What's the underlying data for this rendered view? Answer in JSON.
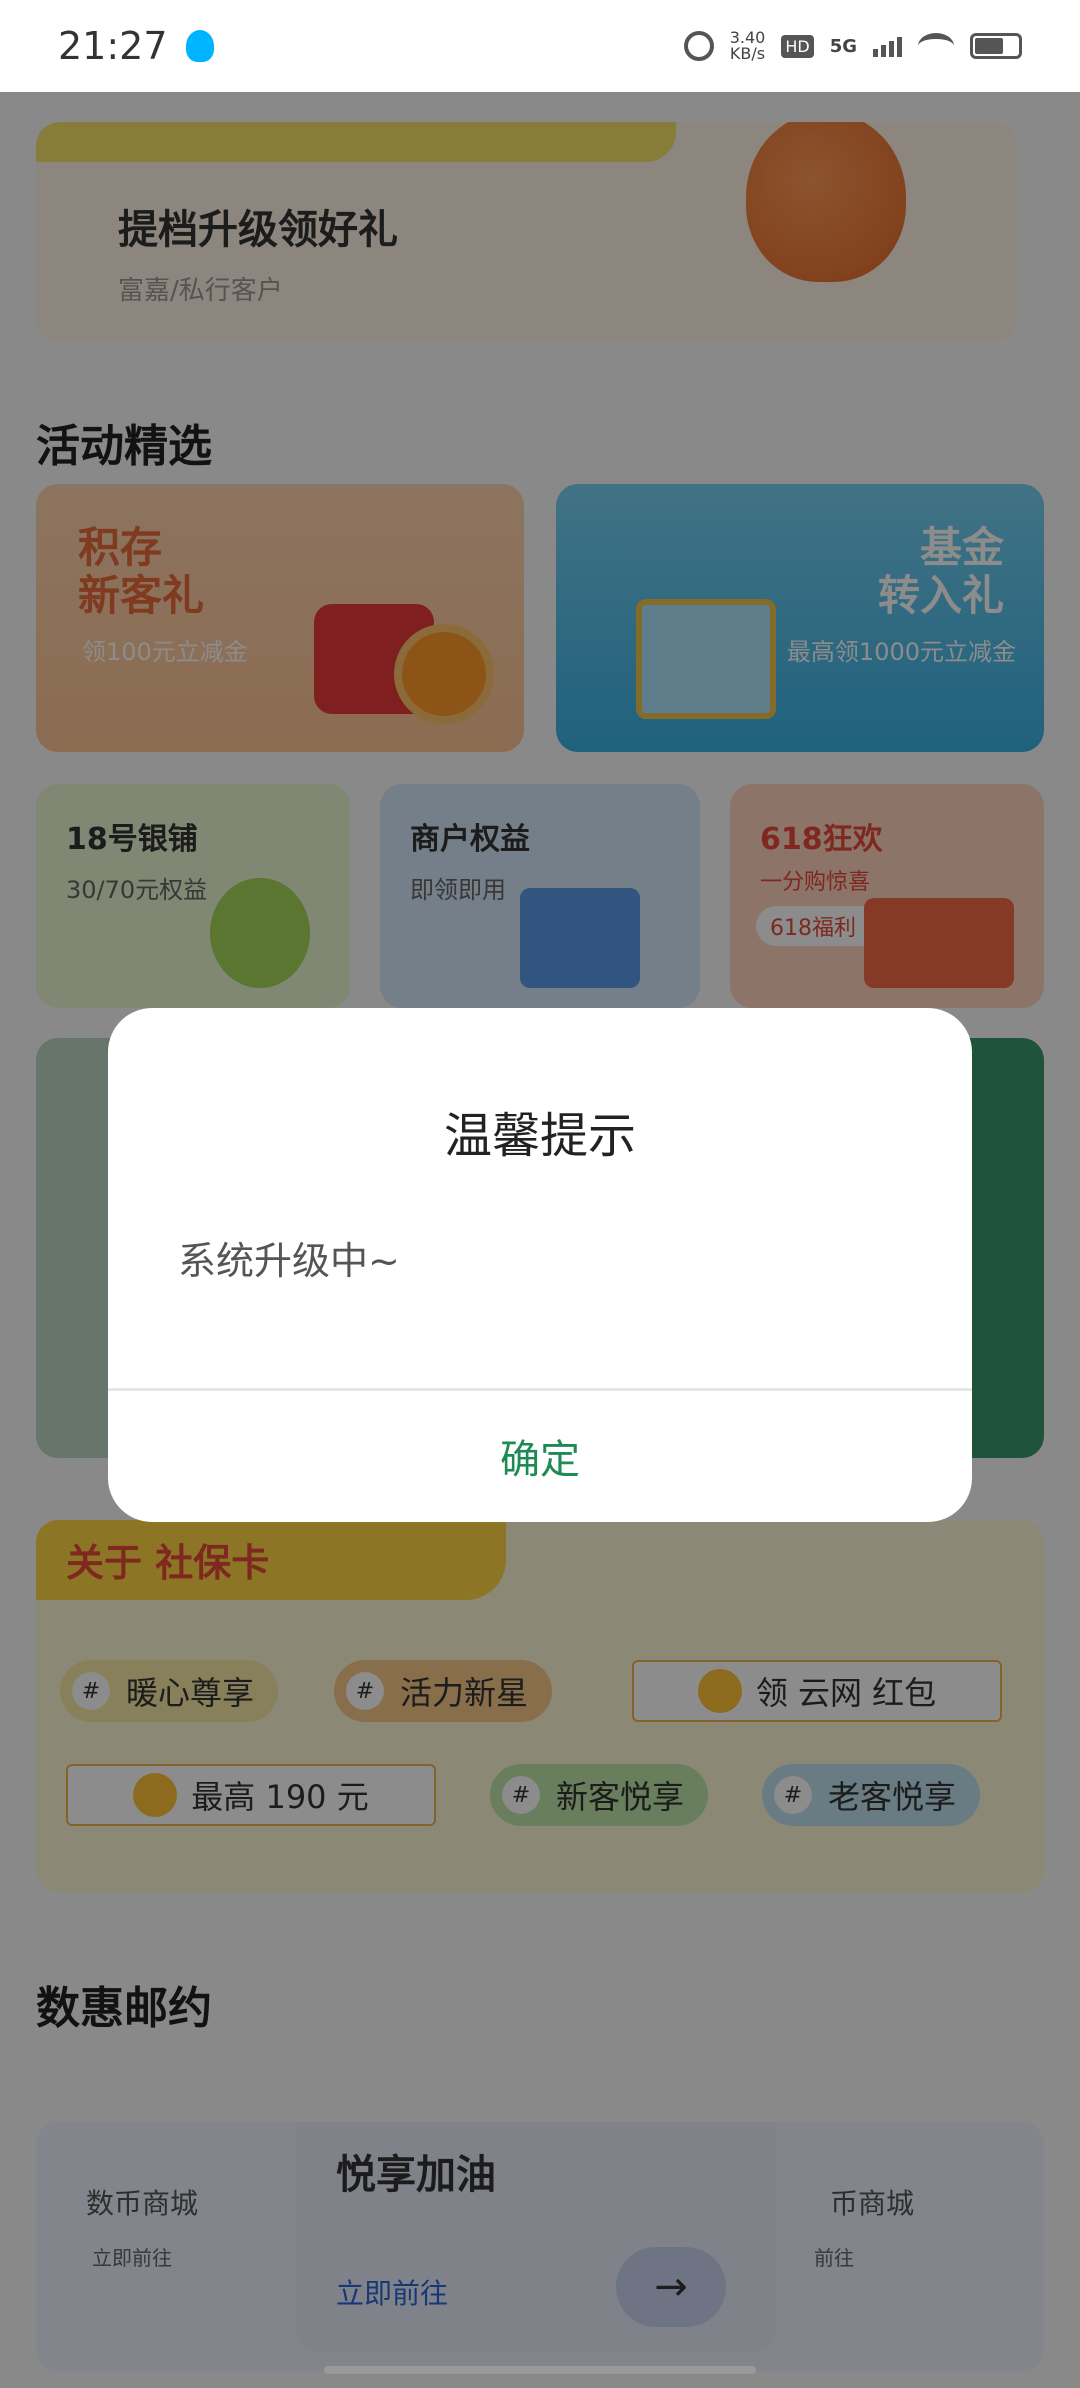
{
  "status_bar": {
    "time": "21:27",
    "speed": "3.40\nKB/s",
    "hd": "HD",
    "network": "5G",
    "colors": {
      "notify_icon": "#00b4ff"
    }
  },
  "hero": {
    "title": "提档升级领好礼",
    "subtitle": "富嘉/私行客户"
  },
  "activities": {
    "title": "活动精选",
    "card1": {
      "title": "积存\n新客礼",
      "sub": "领100元立减金"
    },
    "card2": {
      "title": "基金\n转入礼",
      "sub": "最高领1000元立减金"
    },
    "card3": {
      "title": "18号银铺",
      "sub": "30/70元权益"
    },
    "card4": {
      "title": "商户权益",
      "sub": "即领即用"
    },
    "card5": {
      "title": "618狂欢",
      "sub": "一分购惊喜",
      "pill": "618福利 ›"
    }
  },
  "social": {
    "tag": "关于 社保卡",
    "chips": [
      {
        "hash": "#",
        "label": "暖心尊享"
      },
      {
        "hash": "#",
        "label": "活力新星"
      },
      {
        "hash": "#",
        "label": "新客悦享"
      },
      {
        "hash": "#",
        "label": "老客悦享"
      }
    ],
    "redpacket": "领 云网 红包",
    "max": "最高 190 元"
  },
  "shuhui": {
    "title": "数惠邮约",
    "left_title": "数币商城",
    "left_link": "立即前往",
    "mid_title": "悦享加油",
    "mid_link": "立即前往",
    "right_title": "币商城",
    "right_link": "前往",
    "arrow": "→"
  },
  "dialog": {
    "title": "温馨提示",
    "message": "系统升级中~",
    "confirm": "确定",
    "colors": {
      "confirm": "#1e8a54"
    }
  }
}
